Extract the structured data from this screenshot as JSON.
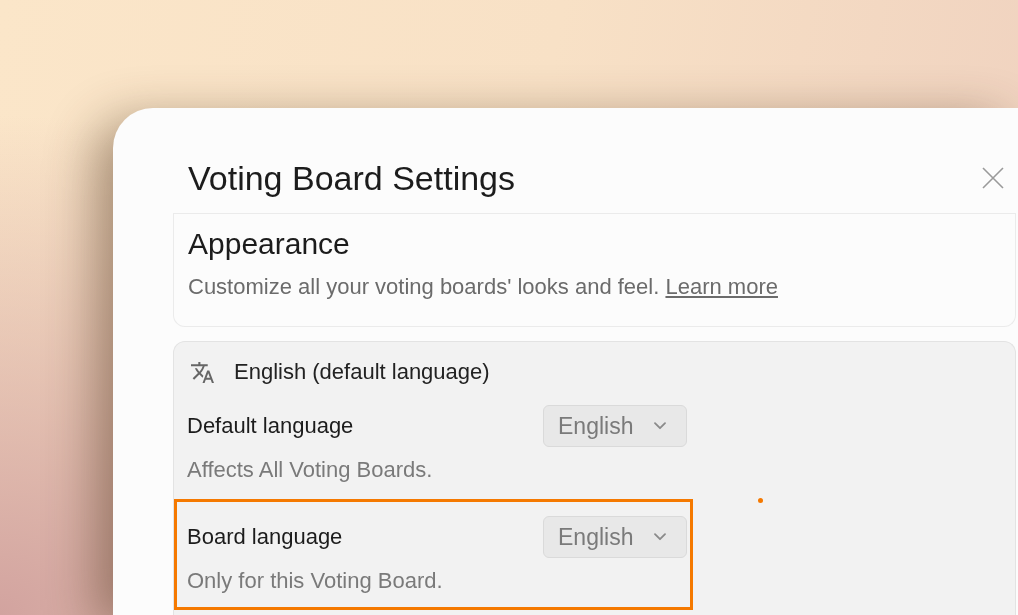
{
  "dialog": {
    "title": "Voting Board Settings"
  },
  "appearance": {
    "title": "Appearance",
    "description": "Customize all your voting boards' looks and feel.",
    "link": "Learn more"
  },
  "language": {
    "header": "English (default language)",
    "settings": [
      {
        "label": "Default language",
        "value": "English",
        "hint": "Affects All Voting Boards.",
        "highlighted": false
      },
      {
        "label": "Board language",
        "value": "English",
        "hint": "Only for this Voting Board.",
        "highlighted": true
      }
    ]
  },
  "pointer_dot": true
}
